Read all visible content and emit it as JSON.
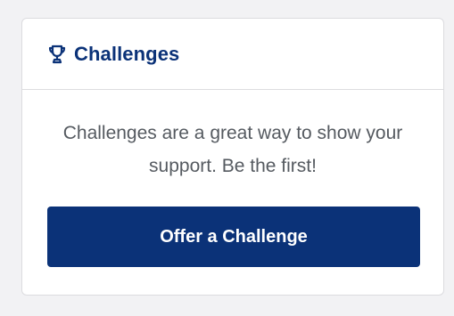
{
  "card": {
    "icon": "trophy-icon",
    "title": "Challenges",
    "description": "Challenges are a great way to show your support. Be the first!",
    "button_label": "Offer a Challenge"
  },
  "colors": {
    "brand": "#0b3278",
    "text_muted": "#555a60",
    "border": "#dcdcdf",
    "background": "#f2f2f4"
  }
}
